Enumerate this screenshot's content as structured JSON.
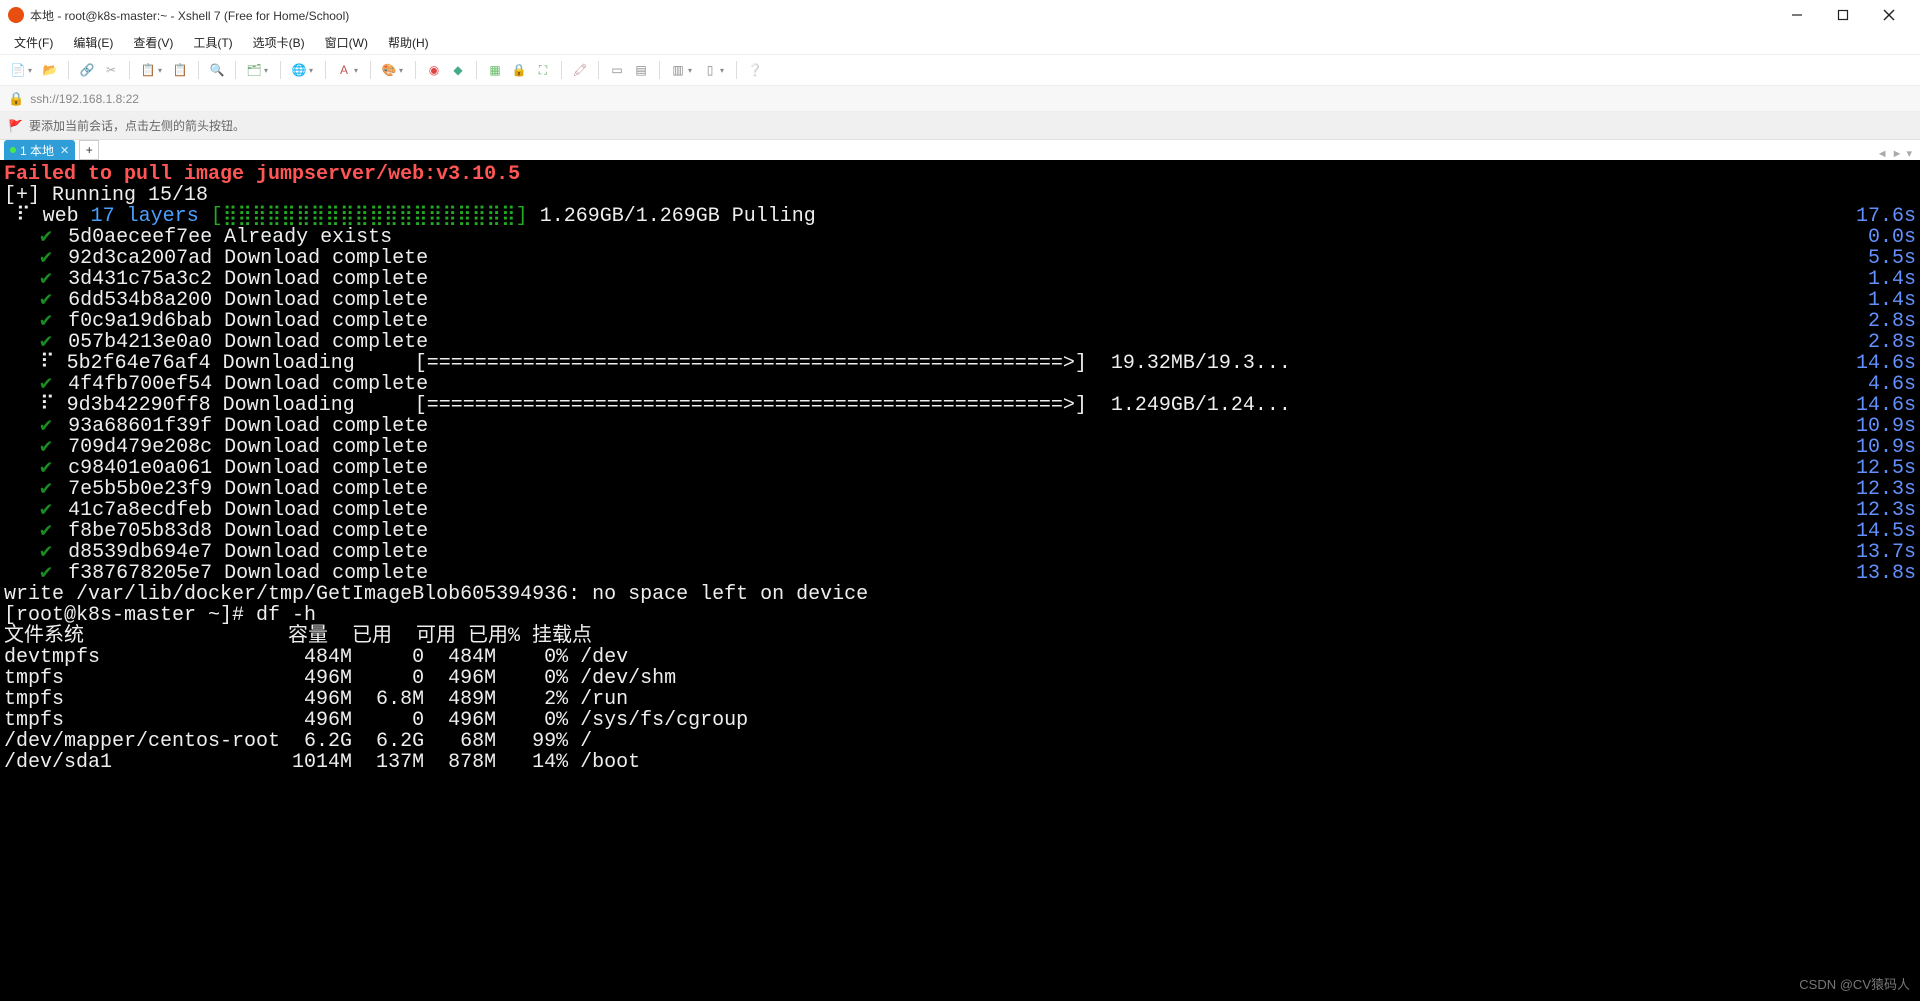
{
  "window": {
    "title": "本地 - root@k8s-master:~ - Xshell 7 (Free for Home/School)"
  },
  "menus": {
    "file": "文件(F)",
    "edit": "编辑(E)",
    "view": "查看(V)",
    "tools": "工具(T)",
    "tabs": "选项卡(B)",
    "window": "窗口(W)",
    "help": "帮助(H)"
  },
  "address": "ssh://192.168.1.8:22",
  "hint": "要添加当前会话，点击左侧的箭头按钮。",
  "tab": {
    "label": "1 本地"
  },
  "terminal": {
    "error": "Failed to pull image jumpserver/web:v3.10.5",
    "running": "[+] Running 15/18",
    "web_line_prefix": " ⠏ web ",
    "web_layers": "17 layers",
    "web_bar": " [⣿⣿⣿⣿⣿⣿⣿⣿⣿⣿⣿⣿⣿⣿⣿⣿⣿⣿⣿⣿] ",
    "web_stats": "1.269GB/1.269GB Pulling",
    "web_time": "17.6s",
    "layers": [
      {
        "hash": "5d0aeceef7ee",
        "status": "Already exists",
        "time": "0.0s",
        "done": true
      },
      {
        "hash": "92d3ca2007ad",
        "status": "Download complete",
        "time": "5.5s",
        "done": true
      },
      {
        "hash": "3d431c75a3c2",
        "status": "Download complete",
        "time": "1.4s",
        "done": true
      },
      {
        "hash": "6dd534b8a200",
        "status": "Download complete",
        "time": "1.4s",
        "done": true
      },
      {
        "hash": "f0c9a19d6bab",
        "status": "Download complete",
        "time": "2.8s",
        "done": true
      },
      {
        "hash": "057b4213e0a0",
        "status": "Download complete",
        "time": "2.8s",
        "done": true
      },
      {
        "hash": "5b2f64e76af4",
        "status": "Downloading",
        "bar": "[=====================================================>]",
        "extra": "19.32MB/19.3...",
        "time": "14.6s",
        "done": false
      },
      {
        "hash": "4f4fb700ef54",
        "status": "Download complete",
        "time": "4.6s",
        "done": true
      },
      {
        "hash": "9d3b42290ff8",
        "status": "Downloading",
        "bar": "[=====================================================>]",
        "extra": "1.249GB/1.24...",
        "time": "14.6s",
        "done": false
      },
      {
        "hash": "93a68601f39f",
        "status": "Download complete",
        "time": "10.9s",
        "done": true
      },
      {
        "hash": "709d479e208c",
        "status": "Download complete",
        "time": "10.9s",
        "done": true
      },
      {
        "hash": "c98401e0a061",
        "status": "Download complete",
        "time": "12.5s",
        "done": true
      },
      {
        "hash": "7e5b5b0e23f9",
        "status": "Download complete",
        "time": "12.3s",
        "done": true
      },
      {
        "hash": "41c7a8ecdfeb",
        "status": "Download complete",
        "time": "12.3s",
        "done": true
      },
      {
        "hash": "f8be705b83d8",
        "status": "Download complete",
        "time": "14.5s",
        "done": true
      },
      {
        "hash": "d8539db694e7",
        "status": "Download complete",
        "time": "13.7s",
        "done": true
      },
      {
        "hash": "f387678205e7",
        "status": "Download complete",
        "time": "13.8s",
        "done": true
      }
    ],
    "write_err": "write /var/lib/docker/tmp/GetImageBlob605394936: no space left on device",
    "prompt": "[root@k8s-master ~]# df -h",
    "df_header": "文件系统                 容量  已用  可用 已用% 挂载点",
    "df_rows": [
      "devtmpfs                 484M     0  484M    0% /dev",
      "tmpfs                    496M     0  496M    0% /dev/shm",
      "tmpfs                    496M  6.8M  489M    2% /run",
      "tmpfs                    496M     0  496M    0% /sys/fs/cgroup",
      "/dev/mapper/centos-root  6.2G  6.2G   68M   99% /",
      "/dev/sda1               1014M  137M  878M   14% /boot"
    ],
    "watermark": "CSDN @CV猿码人"
  }
}
